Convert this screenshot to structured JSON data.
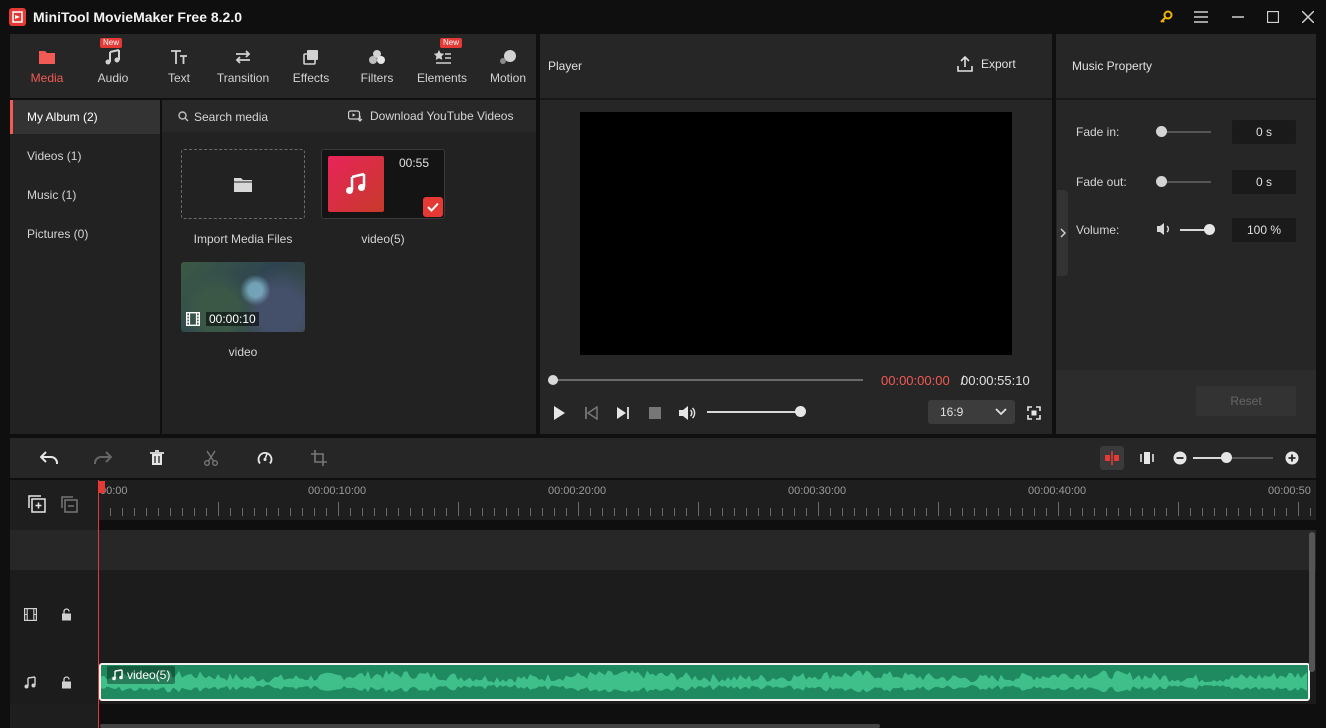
{
  "app": {
    "title": "MiniTool MovieMaker Free 8.2.0"
  },
  "toolbar": {
    "tabs": [
      {
        "label": "Media",
        "icon": "folder-icon",
        "active": true
      },
      {
        "label": "Audio",
        "icon": "music-note-icon",
        "badge": "New"
      },
      {
        "label": "Text",
        "icon": "text-icon"
      },
      {
        "label": "Transition",
        "icon": "transition-arrows-icon"
      },
      {
        "label": "Effects",
        "icon": "effects-icon"
      },
      {
        "label": "Filters",
        "icon": "filters-icon"
      },
      {
        "label": "Elements",
        "icon": "elements-icon",
        "badge": "New"
      },
      {
        "label": "Motion",
        "icon": "motion-icon"
      }
    ]
  },
  "album": {
    "items": [
      {
        "label": "My Album (2)",
        "active": true
      },
      {
        "label": "Videos (1)"
      },
      {
        "label": "Music (1)"
      },
      {
        "label": "Pictures (0)"
      }
    ]
  },
  "media": {
    "search_label": "Search media",
    "youtube_label": "Download YouTube Videos",
    "import_label": "Import Media Files",
    "items": [
      {
        "name": "video(5)",
        "duration": "00:55",
        "type": "music",
        "selected": true
      },
      {
        "name": "video",
        "duration": "00:00:10",
        "type": "video"
      }
    ]
  },
  "player": {
    "title": "Player",
    "export_label": "Export",
    "time_current": "00:00:00:00",
    "time_separator": " / ",
    "time_total": "00:00:55:10",
    "aspect_ratio": "16:9",
    "volume_level": 0.95,
    "seek_position": 0
  },
  "property": {
    "title": "Music Property",
    "fade_in_label": "Fade in:",
    "fade_in_value": "0 s",
    "fade_out_label": "Fade out:",
    "fade_out_value": "0 s",
    "volume_label": "Volume:",
    "volume_value": "100 %",
    "reset_label": "Reset"
  },
  "timeline": {
    "ruler_labels": [
      "00:00",
      "00:00:10:00",
      "00:00:20:00",
      "00:00:30:00",
      "00:00:40:00",
      "00:00:50"
    ],
    "audio_clip_label": "video(5)",
    "zoom_level": 0.42
  },
  "colors": {
    "accent": "#f25a55",
    "clip_green": "#1f8a5f",
    "badge_red": "#e53935"
  }
}
